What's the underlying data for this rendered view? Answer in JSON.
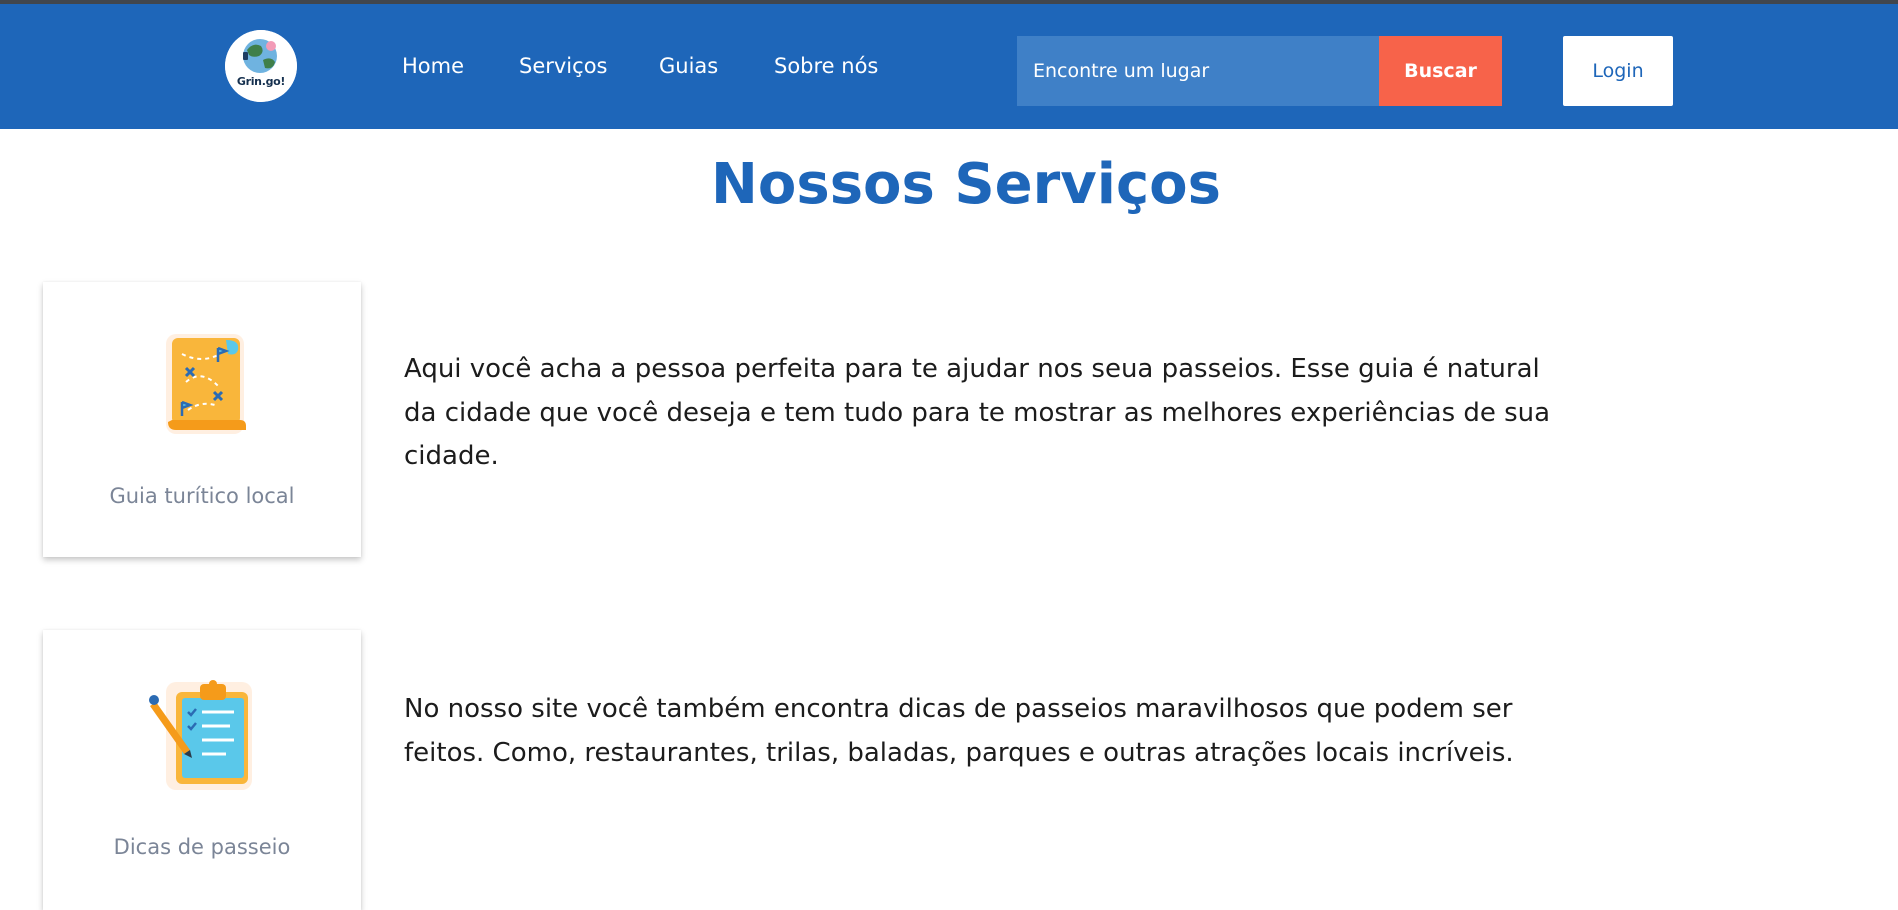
{
  "header": {
    "logo_text": "Grin.go!",
    "nav": [
      "Home",
      "Serviços",
      "Guias",
      "Sobre nós"
    ],
    "search": {
      "placeholder": "Encontre um lugar",
      "button_label": "Buscar"
    },
    "login_label": "Login"
  },
  "main": {
    "title": "Nossos Serviços",
    "services": [
      {
        "label": "Guia turítico local",
        "icon": "treasure-map-icon",
        "description": "Aqui você acha a pessoa perfeita para te ajudar nos seua passeios. Esse guia é natural da cidade que você deseja e tem tudo para te mostrar as melhores experiências de sua cidade."
      },
      {
        "label": "Dicas de passeio",
        "icon": "clipboard-checklist-icon",
        "description": "No nosso site você também encontra dicas de passeios maravilhosos que podem ser feitos. Como, restaurantes, trilas, baladas, parques e outras atrações locais incríveis."
      }
    ]
  },
  "colors": {
    "navbar": "#1e66b9",
    "search_bg": "#3f80c7",
    "buscar_button": "#f7634a",
    "title": "#1e66b9",
    "card_label": "#7b8597"
  }
}
